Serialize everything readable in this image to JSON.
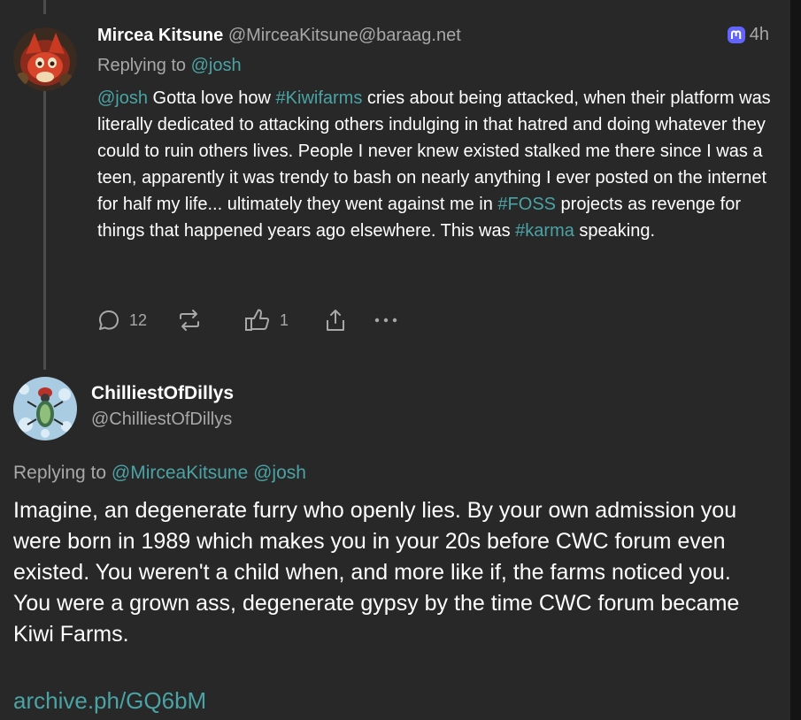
{
  "post1": {
    "author_name": "Mircea Kitsune",
    "author_handle": "@MirceaKitsune@baraag.net",
    "platform_icon": "mastodon-icon",
    "timestamp": "4h",
    "replying_to_label": "Replying to",
    "replying_to_user": "@josh",
    "body": {
      "mention": "@josh",
      "t1": " Gotta love how ",
      "tag1": "#Kiwifarms",
      "t2": " cries about being attacked, when their platform was literally dedicated to attacking others indulging in that hatred and doing whatever they could to ruin others lives. People I never knew existed stalked me there since I was a teen, apparently it was trendy to bash on nearly anything I ever posted on the internet for half my life... ultimately they went against me in ",
      "tag2": "#FOSS",
      "t3": " projects as revenge for things that happened years ago elsewhere. This was ",
      "tag3": "#karma",
      "t4": " speaking."
    },
    "actions": {
      "reply_icon": "reply-icon",
      "reply_count": "12",
      "repost_icon": "repost-icon",
      "like_icon": "thumbs-up-icon",
      "like_count": "1",
      "share_icon": "share-icon",
      "more_icon": "more-icon"
    }
  },
  "post2": {
    "author_name": "ChilliestOfDillys",
    "author_handle": "@ChilliestOfDillys",
    "replying_to_label": "Replying to",
    "replying_to_users": "@MirceaKitsune @josh",
    "body": "Imagine, an degenerate furry who openly lies. By your own admission you were born in 1989 which makes you in your 20s before CWC forum even existed. You weren't a child when, and more like if, the farms noticed you. You were a grown ass, degenerate gypsy by the time CWC forum became Kiwi Farms.",
    "link": "archive.ph/GQ6bM"
  },
  "colors": {
    "background": "#282828",
    "link": "#4aa3a5",
    "muted": "#a8a8a8",
    "mastodon": "#6364ff"
  }
}
